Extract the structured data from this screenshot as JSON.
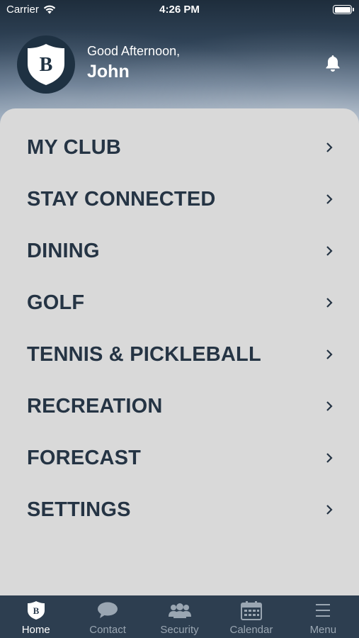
{
  "status_bar": {
    "carrier": "Carrier",
    "time": "4:26 PM",
    "wifi_icon": "wifi-icon",
    "battery_icon": "battery-icon"
  },
  "header": {
    "logo_letter": "B",
    "greeting": "Good Afternoon,",
    "name": "John",
    "bell_icon": "bell-icon"
  },
  "menu": {
    "items": [
      {
        "label": "MY CLUB"
      },
      {
        "label": "STAY CONNECTED"
      },
      {
        "label": "DINING"
      },
      {
        "label": "GOLF"
      },
      {
        "label": "TENNIS & PICKLEBALL"
      },
      {
        "label": "RECREATION"
      },
      {
        "label": "FORECAST"
      },
      {
        "label": "SETTINGS"
      }
    ]
  },
  "tab_bar": {
    "tabs": [
      {
        "label": "Home",
        "icon": "shield-logo-icon",
        "active": true
      },
      {
        "label": "Contact",
        "icon": "chat-bubble-icon",
        "active": false
      },
      {
        "label": "Security",
        "icon": "people-icon",
        "active": false
      },
      {
        "label": "Calendar",
        "icon": "calendar-icon",
        "active": false
      },
      {
        "label": "Menu",
        "icon": "hamburger-menu-icon",
        "active": false
      }
    ]
  },
  "colors": {
    "panel_bg": "#d9d9d9",
    "menu_text": "#253444",
    "tab_bar_bg": "#2d3e50",
    "tab_inactive": "#9aa6b2",
    "tab_active": "#ffffff"
  }
}
